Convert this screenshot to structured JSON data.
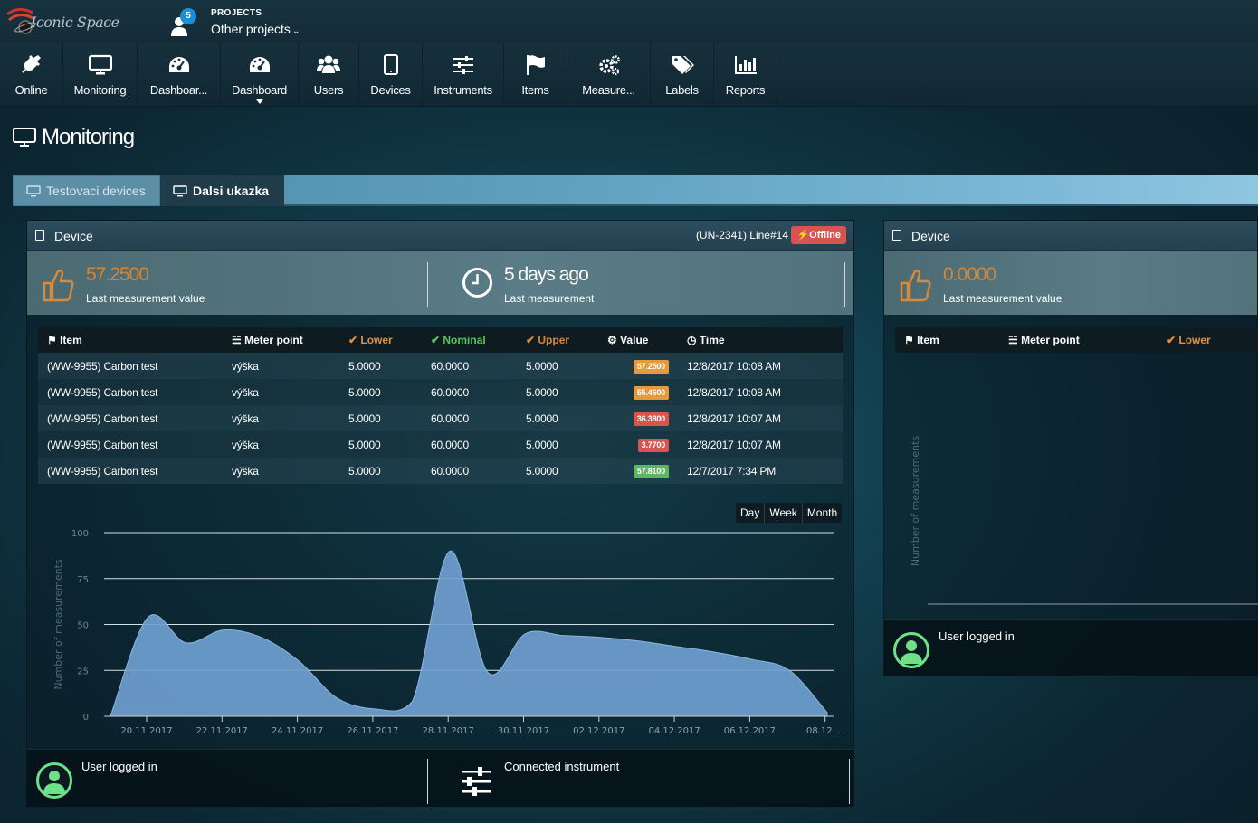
{
  "app": {
    "brand": "Iconic Space",
    "projects_label": "PROJECTS",
    "projects_value": "Other projects",
    "notifications_count": "5"
  },
  "nav": [
    {
      "label": "Online",
      "icon": "plug-icon"
    },
    {
      "label": "Monitoring",
      "icon": "monitor-icon"
    },
    {
      "label": "Dashboar...",
      "icon": "dashboard-icon"
    },
    {
      "label": "Dashboard",
      "icon": "dashboard-icon"
    },
    {
      "label": "Users",
      "icon": "users-icon"
    },
    {
      "label": "Devices",
      "icon": "tablet-icon"
    },
    {
      "label": "Instruments",
      "icon": "sliders-icon"
    },
    {
      "label": "Items",
      "icon": "flag-icon"
    },
    {
      "label": "Measure...",
      "icon": "gears-icon"
    },
    {
      "label": "Labels",
      "icon": "tags-icon"
    },
    {
      "label": "Reports",
      "icon": "bar-chart-icon"
    }
  ],
  "page": {
    "title": "Monitoring"
  },
  "tabs": [
    {
      "label": "Testovaci devices",
      "active": false
    },
    {
      "label": "Dalsi ukazka",
      "active": true
    }
  ],
  "device1": {
    "header": "Device",
    "device_id": "(UN-2341) Line#14",
    "status": "Offline",
    "last_value": "57.2500",
    "last_value_label": "Last measurement value",
    "last_time": "5 days ago",
    "last_time_label": "Last measurement",
    "table": {
      "columns": [
        "Item",
        "Meter point",
        "Lower",
        "Nominal",
        "Upper",
        "Value",
        "Time"
      ],
      "rows": [
        {
          "item": "(WW-9955) Carbon test",
          "meter": "výška",
          "lower": "5.0000",
          "nominal": "60.0000",
          "upper": "5.0000",
          "value": "57.2500",
          "color": "#e69a3c",
          "time": "12/8/2017 10:08 AM"
        },
        {
          "item": "(WW-9955) Carbon test",
          "meter": "výška",
          "lower": "5.0000",
          "nominal": "60.0000",
          "upper": "5.0000",
          "value": "55.4600",
          "color": "#e69a3c",
          "time": "12/8/2017 10:08 AM"
        },
        {
          "item": "(WW-9955) Carbon test",
          "meter": "výška",
          "lower": "5.0000",
          "nominal": "60.0000",
          "upper": "5.0000",
          "value": "36.3800",
          "color": "#d9534f",
          "time": "12/8/2017 10:07 AM"
        },
        {
          "item": "(WW-9955) Carbon test",
          "meter": "výška",
          "lower": "5.0000",
          "nominal": "60.0000",
          "upper": "5.0000",
          "value": "3.7700",
          "color": "#d9534f",
          "time": "12/8/2017 10:07 AM"
        },
        {
          "item": "(WW-9955) Carbon test",
          "meter": "výška",
          "lower": "5.0000",
          "nominal": "60.0000",
          "upper": "5.0000",
          "value": "57.8100",
          "color": "#5cb85c",
          "time": "12/7/2017 7:34 PM"
        }
      ]
    },
    "range_buttons": [
      "Day",
      "Week",
      "Month"
    ],
    "footer": {
      "user_label": "User logged in",
      "instrument_label": "Connected instrument"
    }
  },
  "device2": {
    "header": "Device",
    "last_value": "0.0000",
    "last_value_label": "Last measurement value",
    "columns": [
      "Item",
      "Meter point",
      "Lower"
    ],
    "ylabel": "Number of measurements",
    "footer": {
      "user_label": "User logged in"
    }
  },
  "chart_data": {
    "type": "area",
    "title": "",
    "xlabel": "",
    "ylabel": "Number of measurements",
    "ylim": [
      0,
      100
    ],
    "yticks": [
      0,
      25,
      50,
      75,
      100
    ],
    "xticks": [
      "20.11.2017",
      "22.11.2017",
      "24.11.2017",
      "26.11.2017",
      "28.11.2017",
      "30.11.2017",
      "02.12.2017",
      "04.12.2017",
      "06.12.2017",
      "08.12...."
    ],
    "color": "#6f9fd0",
    "series": [
      {
        "x": [
          "19.11.2017",
          "20.11.2017",
          "21.11.2017",
          "22.11.2017",
          "23.11.2017",
          "24.11.2017",
          "25.11.2017",
          "26.11.2017",
          "27.11.2017",
          "28.11.2017",
          "29.11.2017",
          "30.11.2017",
          "01.12.2017",
          "02.12.2017",
          "03.12.2017",
          "04.12.2017",
          "05.12.2017",
          "06.12.2017",
          "07.12.2017",
          "08.12.2017"
        ],
        "values": [
          0,
          54,
          40,
          47,
          43,
          30,
          10,
          4,
          8,
          90,
          24,
          45,
          44,
          43,
          41,
          38,
          35,
          31,
          25,
          2
        ]
      }
    ]
  }
}
